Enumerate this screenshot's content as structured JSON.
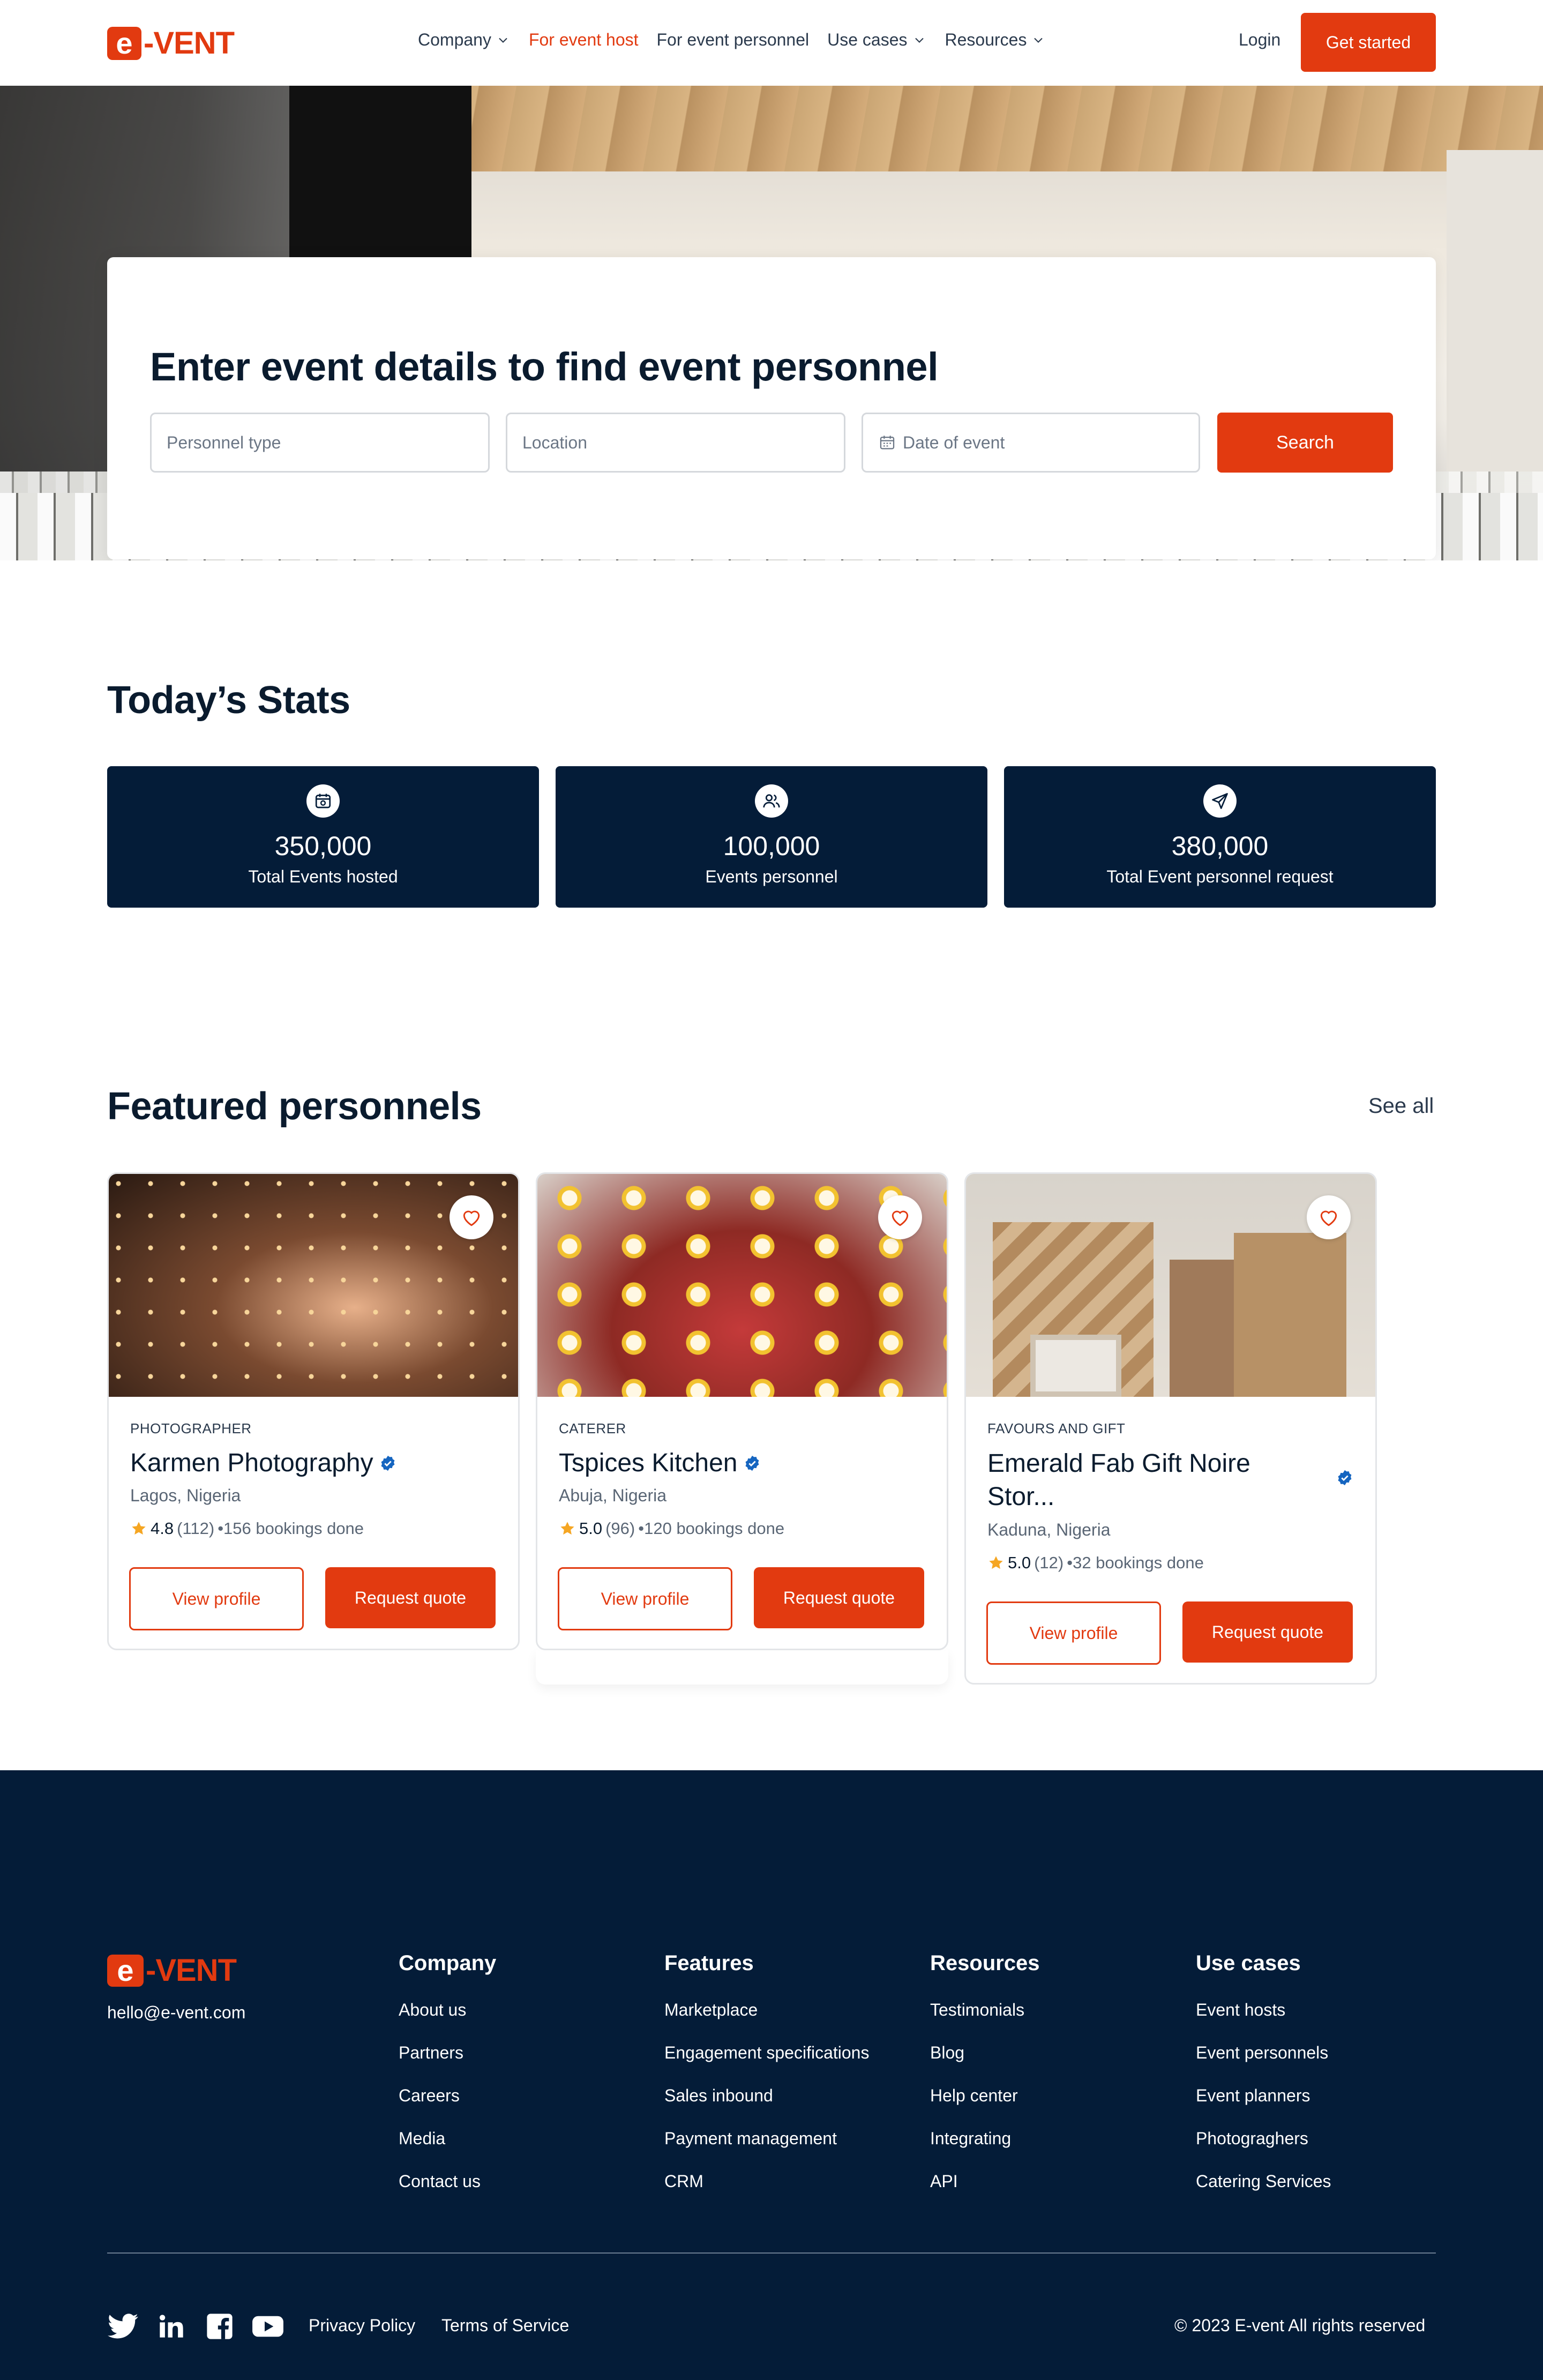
{
  "brand": {
    "logo_mark": "e",
    "logo_text": "-VENT"
  },
  "nav": {
    "links": [
      {
        "label": "Company",
        "has_dropdown": true
      },
      {
        "label": "For event host",
        "active": true
      },
      {
        "label": "For event personnel"
      },
      {
        "label": "Use cases",
        "has_dropdown": true
      },
      {
        "label": "Resources",
        "has_dropdown": true
      }
    ],
    "login": "Login",
    "get_started": "Get started"
  },
  "hero": {
    "title": "Enter event details to find event personnel",
    "personnel_placeholder": "Personnel type",
    "location_placeholder": "Location",
    "date_placeholder": "Date of event",
    "search_button": "Search"
  },
  "stats": {
    "title": "Today’s Stats",
    "items": [
      {
        "icon": "calendar-icon",
        "value": "350,000",
        "label": "Total Events hosted"
      },
      {
        "icon": "users-icon",
        "value": "100,000",
        "label": "Events personnel"
      },
      {
        "icon": "send-icon",
        "value": "380,000",
        "label": "Total Event personnel request"
      }
    ]
  },
  "featured": {
    "title": "Featured personnels",
    "see_all": "See all",
    "cards": [
      {
        "category": "PHOTOGRAPHER",
        "name": "Karmen Photography",
        "location": "Lagos, Nigeria",
        "rating": "4.8",
        "reviews": "(112)",
        "bookings": "•156 bookings done",
        "view": "View profile",
        "quote": "Request quote"
      },
      {
        "category": "CATERER",
        "name": "Tspices Kitchen",
        "location": "Abuja, Nigeria",
        "rating": "5.0",
        "reviews": "(96)",
        "bookings": "•120 bookings done",
        "view": "View profile",
        "quote": "Request quote"
      },
      {
        "category": "FAVOURS AND GIFT",
        "name": "Emerald Fab Gift Noire Stor...",
        "location": "Kaduna, Nigeria",
        "rating": "5.0",
        "reviews": "(12)",
        "bookings": "•32 bookings done",
        "view": "View profile",
        "quote": "Request quote"
      }
    ]
  },
  "footer": {
    "email": "hello@e-vent.com",
    "columns": [
      {
        "title": "Company",
        "items": [
          "About us",
          "Partners",
          "Careers",
          "Media",
          "Contact us"
        ]
      },
      {
        "title": "Features",
        "items": [
          "Marketplace",
          "Engagement specifications",
          "Sales inbound",
          "Payment management",
          "CRM"
        ]
      },
      {
        "title": "Resources",
        "items": [
          "Testimonials",
          "Blog",
          "Help center",
          "Integrating",
          "API"
        ]
      },
      {
        "title": "Use cases",
        "items": [
          "Event hosts",
          "Event personnels",
          "Event planners",
          "Photograghers",
          "Catering Services"
        ]
      }
    ],
    "socials": [
      "twitter-icon",
      "linkedin-icon",
      "facebook-icon",
      "youtube-icon"
    ],
    "privacy": "Privacy Policy",
    "terms": "Terms of Service",
    "copyright": "© 2023 E-vent All rights reserved"
  },
  "colors": {
    "accent": "#e23a10",
    "navy": "#041c38",
    "text": "#0a1b2e",
    "star": "#f5a623",
    "verified": "#1565c0"
  }
}
